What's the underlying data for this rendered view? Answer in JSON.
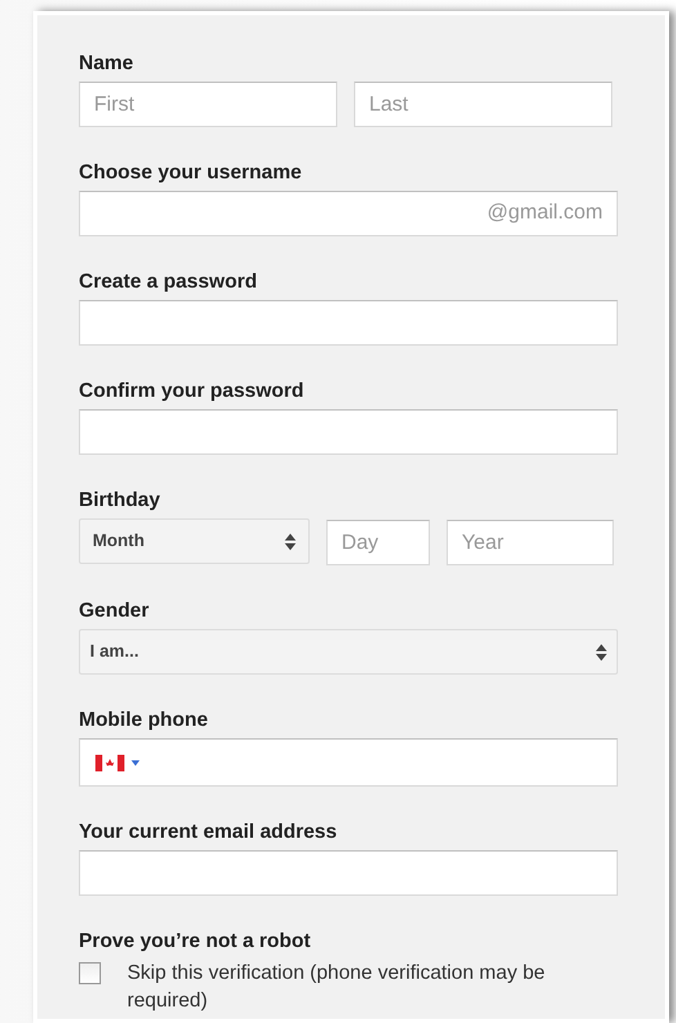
{
  "form": [
    {
      "kind": "name",
      "label": "Name",
      "first": {
        "placeholder": "First"
      },
      "last": {
        "placeholder": "Last"
      }
    },
    {
      "kind": "username",
      "label": "Choose your username",
      "suffix": "@gmail.com"
    },
    {
      "kind": "text",
      "label": "Create a password"
    },
    {
      "kind": "text",
      "label": "Confirm your password"
    },
    {
      "kind": "birthday",
      "label": "Birthday",
      "month": "Month",
      "day": {
        "placeholder": "Day"
      },
      "year": {
        "placeholder": "Year"
      }
    },
    {
      "kind": "select",
      "label": "Gender",
      "value": "I am..."
    },
    {
      "kind": "phone",
      "label": "Mobile phone"
    },
    {
      "kind": "text",
      "label": "Your current email address"
    },
    {
      "kind": "checkbox",
      "label": "Prove you’re not a robot",
      "option": "Skip this verification (phone verification may be required)",
      "checked": false
    }
  ]
}
